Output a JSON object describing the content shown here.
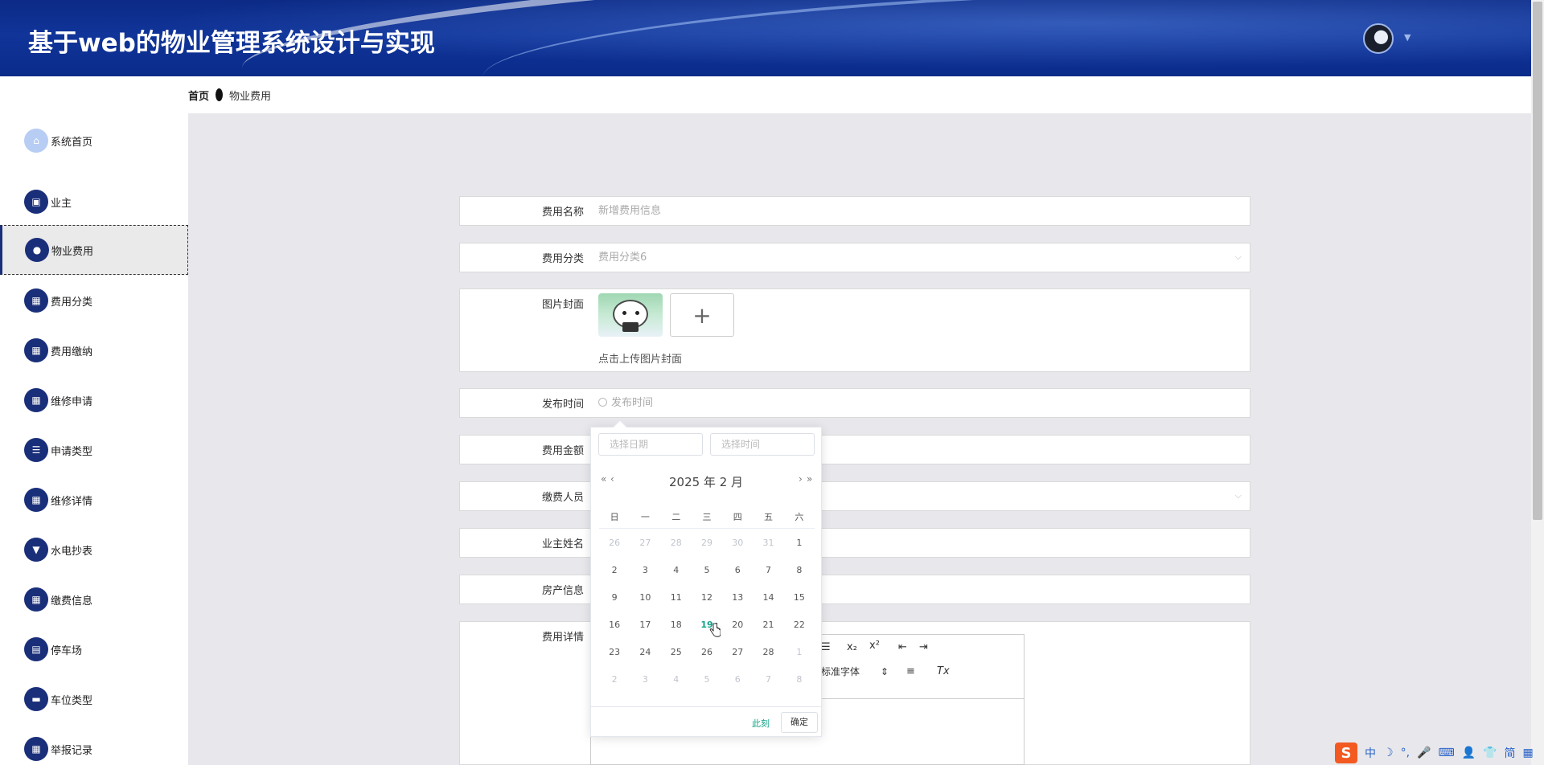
{
  "header": {
    "title": "基于web的物业管理系统设计与实现"
  },
  "breadcrumb": {
    "home": "首页",
    "current": "物业费用"
  },
  "sidebar": {
    "items": [
      {
        "label": "系统首页",
        "icon": "home-icon"
      },
      {
        "label": "业主",
        "icon": "briefcase-icon"
      },
      {
        "label": "物业费用",
        "icon": "pin-icon"
      },
      {
        "label": "费用分类",
        "icon": "grid-icon"
      },
      {
        "label": "费用缴纳",
        "icon": "grid-icon"
      },
      {
        "label": "维修申请",
        "icon": "grid-icon"
      },
      {
        "label": "申请类型",
        "icon": "list-icon"
      },
      {
        "label": "维修详情",
        "icon": "grid-icon"
      },
      {
        "label": "水电抄表",
        "icon": "stamp-icon"
      },
      {
        "label": "缴费信息",
        "icon": "grid-icon"
      },
      {
        "label": "停车场",
        "icon": "chart-icon"
      },
      {
        "label": "车位类型",
        "icon": "chat-icon"
      },
      {
        "label": "举报记录",
        "icon": "grid-icon"
      }
    ],
    "active": "物业费用"
  },
  "form": {
    "fee_name": {
      "label": "费用名称",
      "placeholder": "新增费用信息"
    },
    "fee_category": {
      "label": "费用分类",
      "value": "费用分类6"
    },
    "cover": {
      "label": "图片封面",
      "tip": "点击上传图片封面",
      "plus": "+"
    },
    "publish_time": {
      "label": "发布时间",
      "placeholder": "发布时间"
    },
    "fee_amount": {
      "label": "费用金额"
    },
    "payer": {
      "label": "缴费人员"
    },
    "owner_name": {
      "label": "业主姓名"
    },
    "property_info": {
      "label": "房产信息"
    },
    "fee_detail": {
      "label": "费用详情"
    }
  },
  "editor": {
    "font_select": "标准字体",
    "buttons": [
      "☰",
      "x₂",
      "x²",
      "⇤",
      "⇥",
      "≡",
      "Tx"
    ]
  },
  "datepicker": {
    "date_placeholder": "选择日期",
    "time_placeholder": "选择时间",
    "title": "2025 年  2 月",
    "year_prev": "«",
    "month_prev": "‹",
    "month_next": "›",
    "year_next": "»",
    "weekdays": [
      "日",
      "一",
      "二",
      "三",
      "四",
      "五",
      "六"
    ],
    "weeks": [
      [
        "26",
        "27",
        "28",
        "29",
        "30",
        "31",
        "1"
      ],
      [
        "2",
        "3",
        "4",
        "5",
        "6",
        "7",
        "8"
      ],
      [
        "9",
        "10",
        "11",
        "12",
        "13",
        "14",
        "15"
      ],
      [
        "16",
        "17",
        "18",
        "19",
        "20",
        "21",
        "22"
      ],
      [
        "23",
        "24",
        "25",
        "26",
        "27",
        "28",
        "1"
      ],
      [
        "2",
        "3",
        "4",
        "5",
        "6",
        "7",
        "8"
      ]
    ],
    "today": "19",
    "now_label": "此刻",
    "ok_label": "确定"
  },
  "ime": {
    "items": [
      "S",
      "中",
      "☽",
      "°,",
      "🎤",
      "⌨",
      "👤",
      "👕",
      "简",
      "▦"
    ]
  },
  "colors": {
    "header": "#0c2a86",
    "accent": "#13a28a",
    "sidebar_icon": "#1a2f7a"
  }
}
